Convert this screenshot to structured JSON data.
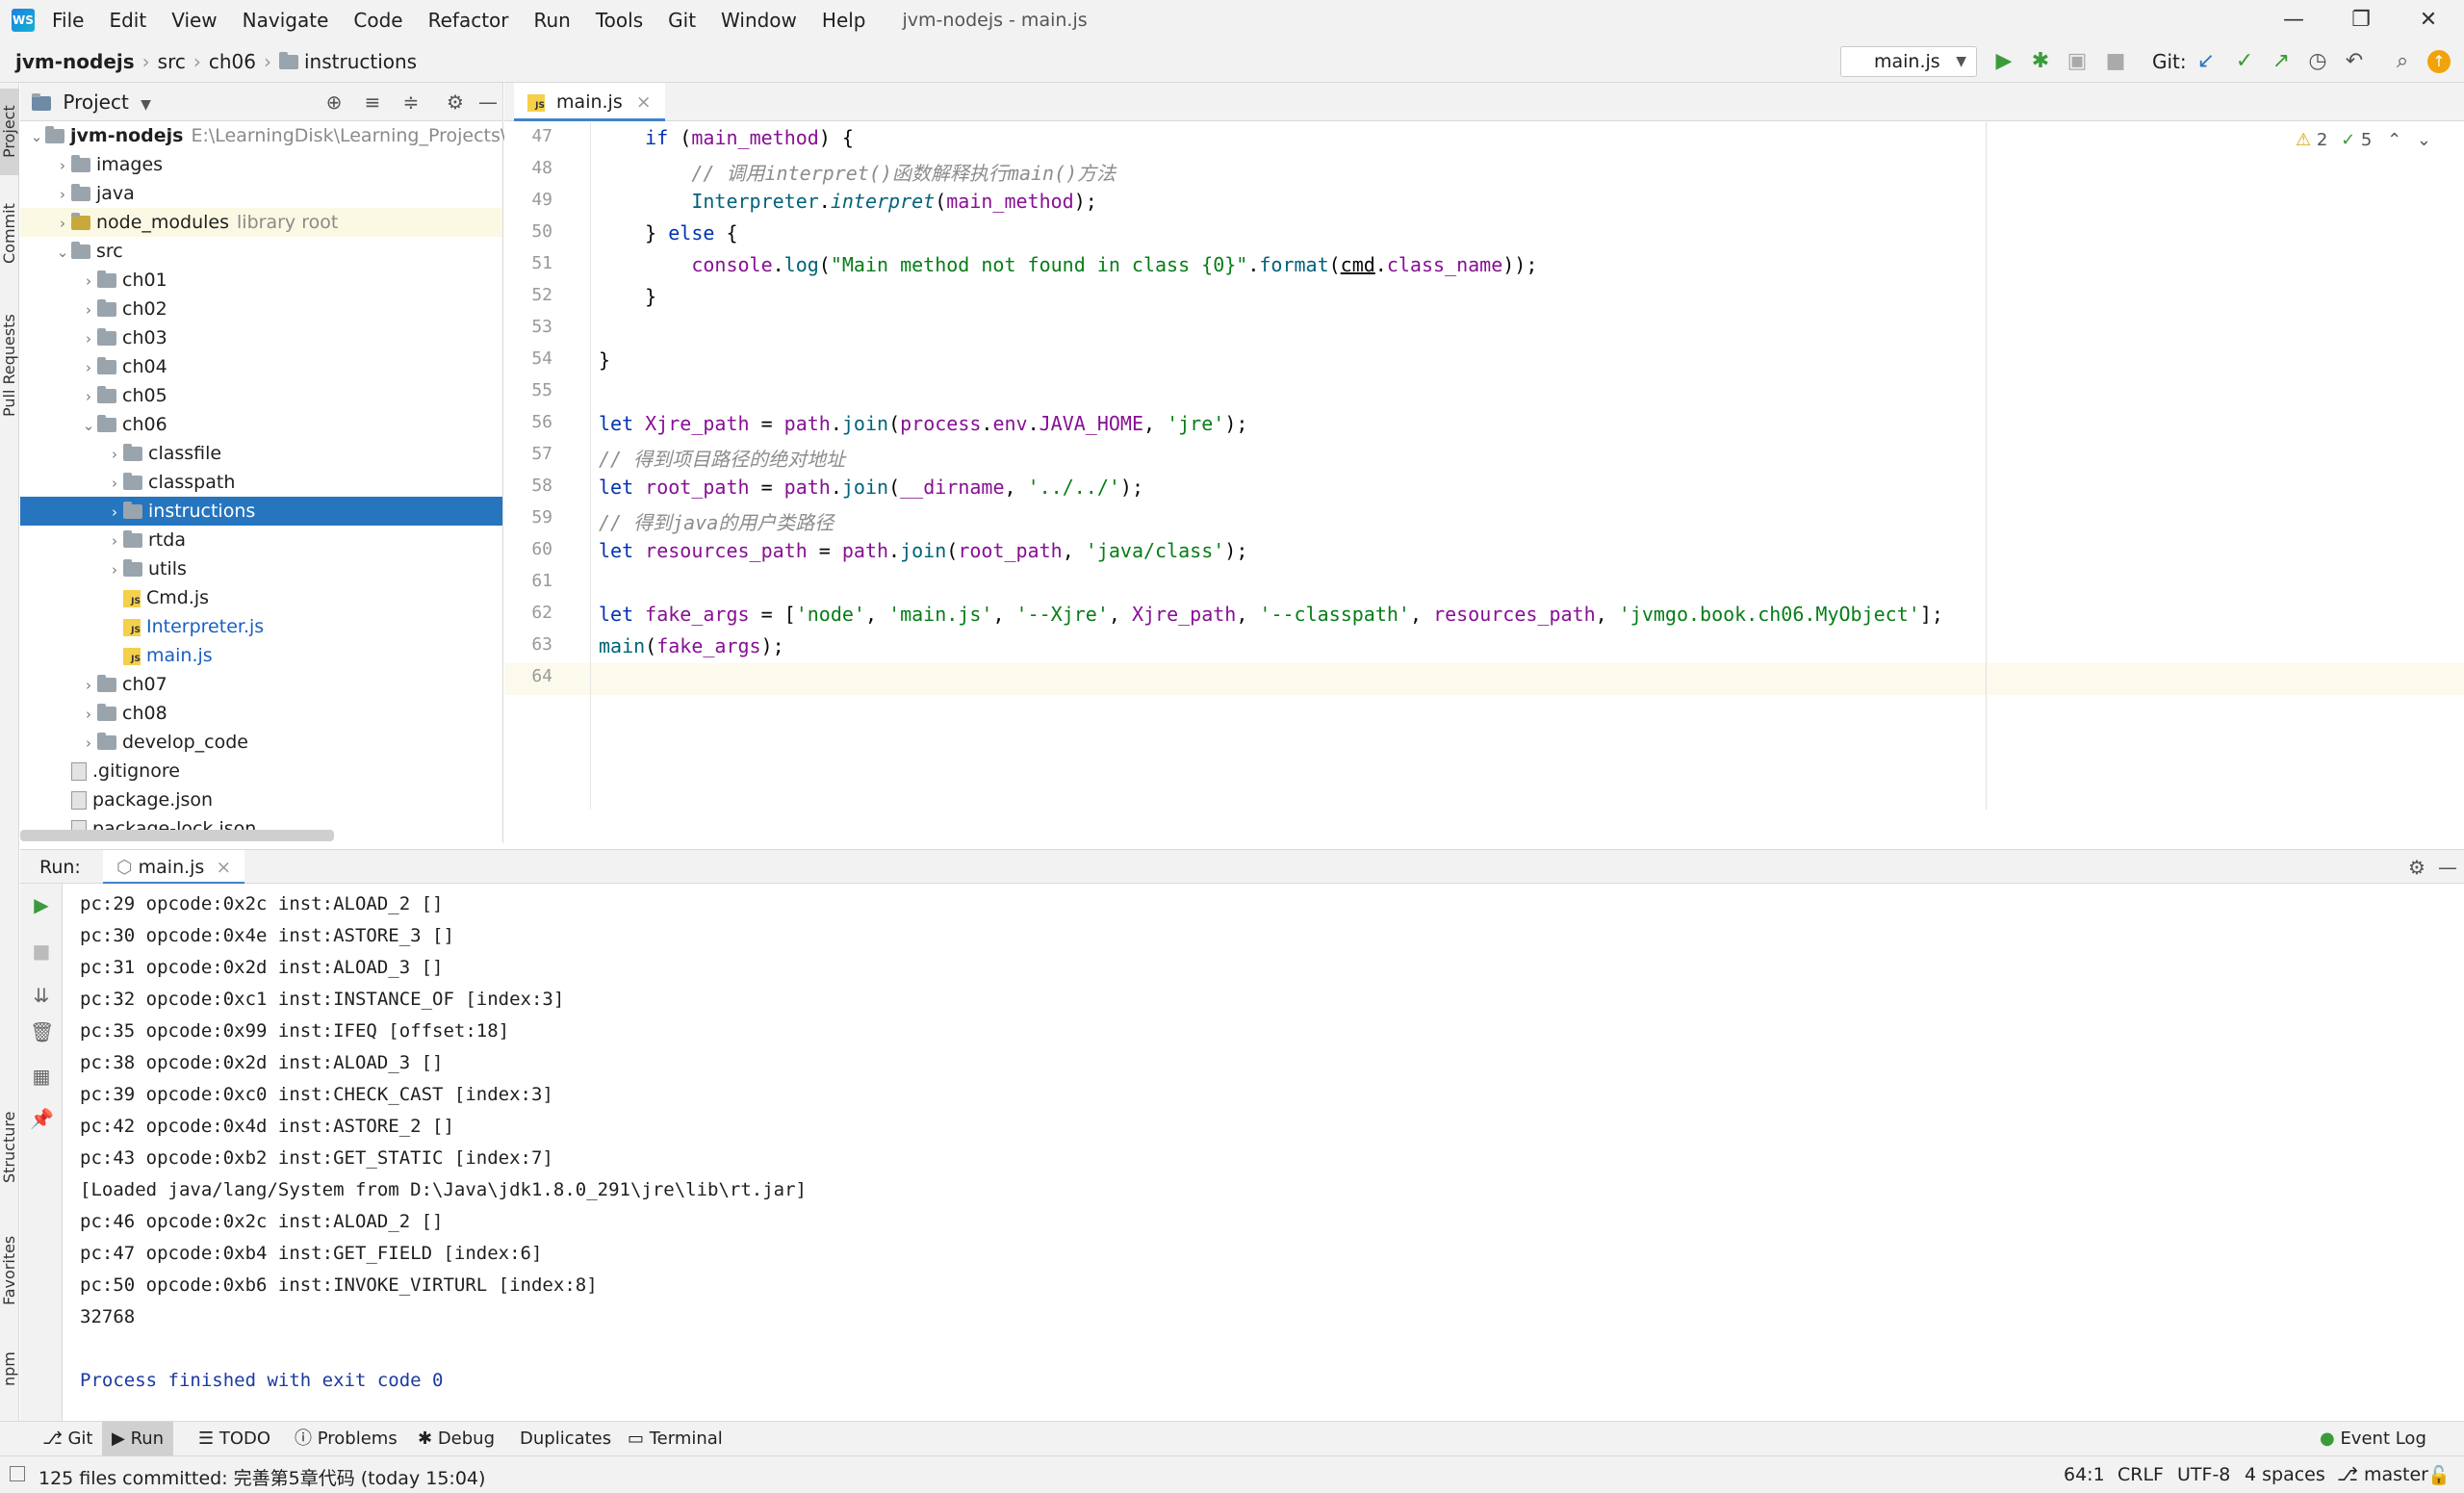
{
  "app": {
    "logo": "WS",
    "window_title": "jvm-nodejs - main.js"
  },
  "menu": [
    "File",
    "Edit",
    "View",
    "Navigate",
    "Code",
    "Refactor",
    "Run",
    "Tools",
    "Git",
    "Window",
    "Help"
  ],
  "window_controls": {
    "minimize": "—",
    "restore": "❐",
    "close": "✕"
  },
  "breadcrumb": [
    "jvm-nodejs",
    "src",
    "ch06",
    "instructions"
  ],
  "toolbar": {
    "run_config": "main.js",
    "git_label": "Git:"
  },
  "left_strip": [
    "Project",
    "Commit",
    "Pull Requests",
    "Structure",
    "Favorites",
    "npm"
  ],
  "project": {
    "title": "Project",
    "tree": [
      {
        "label": "jvm-nodejs",
        "hint": "E:\\LearningDisk\\Learning_Projects\\M",
        "kind": "root",
        "depth": 0,
        "chev": "v"
      },
      {
        "label": "images",
        "kind": "folder",
        "depth": 1,
        "chev": ">"
      },
      {
        "label": "java",
        "kind": "folder",
        "depth": 1,
        "chev": ">"
      },
      {
        "label": "node_modules",
        "hint": "library root",
        "kind": "lib",
        "depth": 1,
        "chev": ">"
      },
      {
        "label": "src",
        "kind": "folder",
        "depth": 1,
        "chev": "v"
      },
      {
        "label": "ch01",
        "kind": "folder",
        "depth": 2,
        "chev": ">"
      },
      {
        "label": "ch02",
        "kind": "folder",
        "depth": 2,
        "chev": ">"
      },
      {
        "label": "ch03",
        "kind": "folder",
        "depth": 2,
        "chev": ">"
      },
      {
        "label": "ch04",
        "kind": "folder",
        "depth": 2,
        "chev": ">"
      },
      {
        "label": "ch05",
        "kind": "folder",
        "depth": 2,
        "chev": ">"
      },
      {
        "label": "ch06",
        "kind": "folder",
        "depth": 2,
        "chev": "v"
      },
      {
        "label": "classfile",
        "kind": "folder",
        "depth": 3,
        "chev": ">"
      },
      {
        "label": "classpath",
        "kind": "folder",
        "depth": 3,
        "chev": ">"
      },
      {
        "label": "instructions",
        "kind": "folder",
        "depth": 3,
        "chev": ">",
        "selected": true
      },
      {
        "label": "rtda",
        "kind": "folder",
        "depth": 3,
        "chev": ">"
      },
      {
        "label": "utils",
        "kind": "folder",
        "depth": 3,
        "chev": ">"
      },
      {
        "label": "Cmd.js",
        "kind": "js",
        "depth": 3
      },
      {
        "label": "Interpreter.js",
        "kind": "js-mod",
        "depth": 3
      },
      {
        "label": "main.js",
        "kind": "js-mod",
        "depth": 3
      },
      {
        "label": "ch07",
        "kind": "folder",
        "depth": 2,
        "chev": ">"
      },
      {
        "label": "ch08",
        "kind": "folder",
        "depth": 2,
        "chev": ">"
      },
      {
        "label": "develop_code",
        "kind": "folder",
        "depth": 2,
        "chev": ">"
      },
      {
        "label": ".gitignore",
        "kind": "file",
        "depth": 1
      },
      {
        "label": "package.json",
        "kind": "file",
        "depth": 1
      },
      {
        "label": "package-lock.json",
        "kind": "file",
        "depth": 1
      }
    ]
  },
  "editor": {
    "tab": "main.js",
    "inspections": {
      "warnings": "2",
      "ok": "5"
    },
    "lines": [
      {
        "n": "47",
        "html": "    <span class='kw'>if</span> (<span class='pr'>main_method</span>) {"
      },
      {
        "n": "48",
        "html": "        <span class='cm'>// 调用interpret()函数解释执行main()方法</span>"
      },
      {
        "n": "49",
        "html": "        <span class='fn'>Interpreter</span>.<span class='fn' style='font-style:italic'>interpret</span>(<span class='pr'>main_method</span>);"
      },
      {
        "n": "50",
        "html": "    } <span class='kw'>else</span> {"
      },
      {
        "n": "51",
        "html": "        <span class='pr'>console</span>.<span class='fn'>log</span>(<span class='st'>\"Main method not found in class {0}\"</span>.<span class='fn'>format</span>(<span style='text-decoration:underline'>cmd</span>.<span class='pr'>class_name</span>));"
      },
      {
        "n": "52",
        "html": "    }"
      },
      {
        "n": "53",
        "html": ""
      },
      {
        "n": "54",
        "html": "}"
      },
      {
        "n": "55",
        "html": ""
      },
      {
        "n": "56",
        "html": "<span class='kw'>let</span> <span class='pr'>Xjre_path</span> = <span class='pr'>path</span>.<span class='fn'>join</span>(<span class='pr'>process</span>.<span class='pr'>env</span>.<span class='pr'>JAVA_HOME</span>, <span class='st'>'jre'</span>);"
      },
      {
        "n": "57",
        "html": "<span class='cm'>// 得到项目路径的绝对地址</span>"
      },
      {
        "n": "58",
        "html": "<span class='kw'>let</span> <span class='pr'>root_path</span> = <span class='pr'>path</span>.<span class='fn'>join</span>(<span class='pr'>__dirname</span>, <span class='st'>'../../'</span>);"
      },
      {
        "n": "59",
        "html": "<span class='cm'>// 得到java的用户类路径</span>"
      },
      {
        "n": "60",
        "html": "<span class='kw'>let</span> <span class='pr'>resources_path</span> = <span class='pr'>path</span>.<span class='fn'>join</span>(<span class='pr'>root_path</span>, <span class='st'>'java/class'</span>);"
      },
      {
        "n": "61",
        "html": ""
      },
      {
        "n": "62",
        "html": "<span class='kw'>let</span> <span class='pr'>fake_args</span> = [<span class='st'>'node'</span>, <span class='st'>'main.js'</span>, <span class='st'>'--Xjre'</span>, <span class='pr'>Xjre_path</span>, <span class='st'>'--classpath'</span>, <span class='pr'>resources_path</span>, <span class='st'>'jvmgo.book.ch06.MyObject'</span>];"
      },
      {
        "n": "63",
        "html": "<span class='fn'>main</span>(<span class='pr'>fake_args</span>);"
      },
      {
        "n": "64",
        "html": ""
      }
    ]
  },
  "run": {
    "label": "Run:",
    "tab": "main.js",
    "output": [
      "pc:29 opcode:0x2c inst:ALOAD_2 []",
      "pc:30 opcode:0x4e inst:ASTORE_3 []",
      "pc:31 opcode:0x2d inst:ALOAD_3 []",
      "pc:32 opcode:0xc1 inst:INSTANCE_OF [index:3]",
      "pc:35 opcode:0x99 inst:IFEQ [offset:18]",
      "pc:38 opcode:0x2d inst:ALOAD_3 []",
      "pc:39 opcode:0xc0 inst:CHECK_CAST [index:3]",
      "pc:42 opcode:0x4d inst:ASTORE_2 []",
      "pc:43 opcode:0xb2 inst:GET_STATIC [index:7]",
      "[Loaded java/lang/System from D:\\Java\\jdk1.8.0_291\\jre\\lib\\rt.jar]",
      "pc:46 opcode:0x2c inst:ALOAD_2 []",
      "pc:47 opcode:0xb4 inst:GET_FIELD [index:6]",
      "pc:50 opcode:0xb6 inst:INVOKE_VIRTURL [index:8]",
      "32768",
      "",
      "Process finished with exit code 0"
    ]
  },
  "bottom_tools": [
    "Git",
    "Run",
    "TODO",
    "Problems",
    "Debug",
    "Duplicates",
    "Terminal"
  ],
  "event_log": "Event Log",
  "status": {
    "message": "125 files committed: 完善第5章代码 (today 15:04)",
    "position": "64:1",
    "line_sep": "CRLF",
    "encoding": "UTF-8",
    "indent": "4 spaces",
    "branch": "master"
  }
}
